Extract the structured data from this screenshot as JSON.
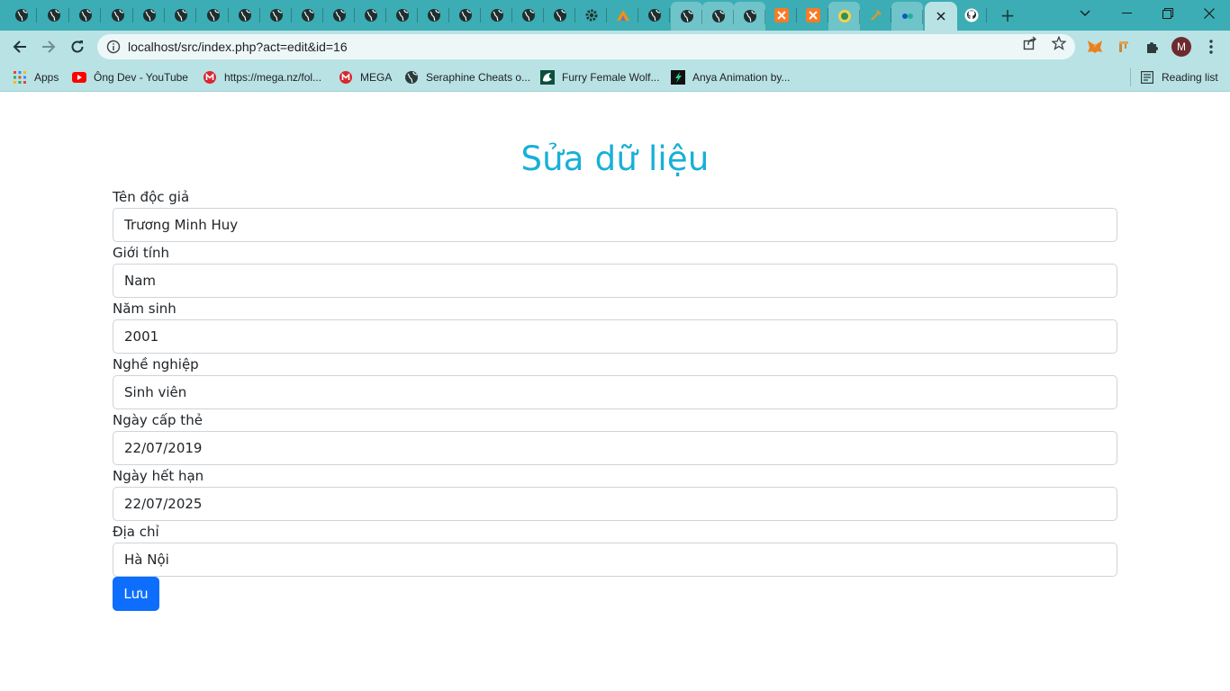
{
  "browser": {
    "url": "localhost/src/index.php?act=edit&id=16",
    "new_tab_label": "+",
    "profile_initial": "M",
    "bookmarks": [
      {
        "label": "Apps",
        "icon": "apps-grid-icon"
      },
      {
        "label": "Ông Dev - YouTube",
        "icon": "youtube-icon"
      },
      {
        "label": "https://mega.nz/fol...",
        "icon": "mega-icon"
      },
      {
        "label": "MEGA",
        "icon": "mega-icon"
      },
      {
        "label": "Seraphine Cheats o...",
        "icon": "globe-icon"
      },
      {
        "label": "Furry Female Wolf...",
        "icon": "site-icon"
      },
      {
        "label": "Anya Animation by...",
        "icon": "site-icon"
      }
    ],
    "reading_list": "Reading list"
  },
  "form": {
    "title": "Sửa dữ liệu",
    "fields": [
      {
        "label": "Tên độc giả",
        "value": "Trương Minh Huy"
      },
      {
        "label": "Giới tính",
        "value": "Nam"
      },
      {
        "label": "Năm sinh",
        "value": "2001"
      },
      {
        "label": "Nghề nghiệp",
        "value": "Sinh viên"
      },
      {
        "label": "Ngày cấp thẻ",
        "value": "22/07/2019"
      },
      {
        "label": "Ngày hết hạn",
        "value": "22/07/2025"
      },
      {
        "label": "Địa chỉ",
        "value": "Hà Nội"
      }
    ],
    "save_label": "Lưu"
  },
  "colors": {
    "tabstrip": "#3cadb4",
    "toolbar": "#b9e2e5",
    "title": "#17b0d8",
    "primary_button": "#0d6efd"
  }
}
